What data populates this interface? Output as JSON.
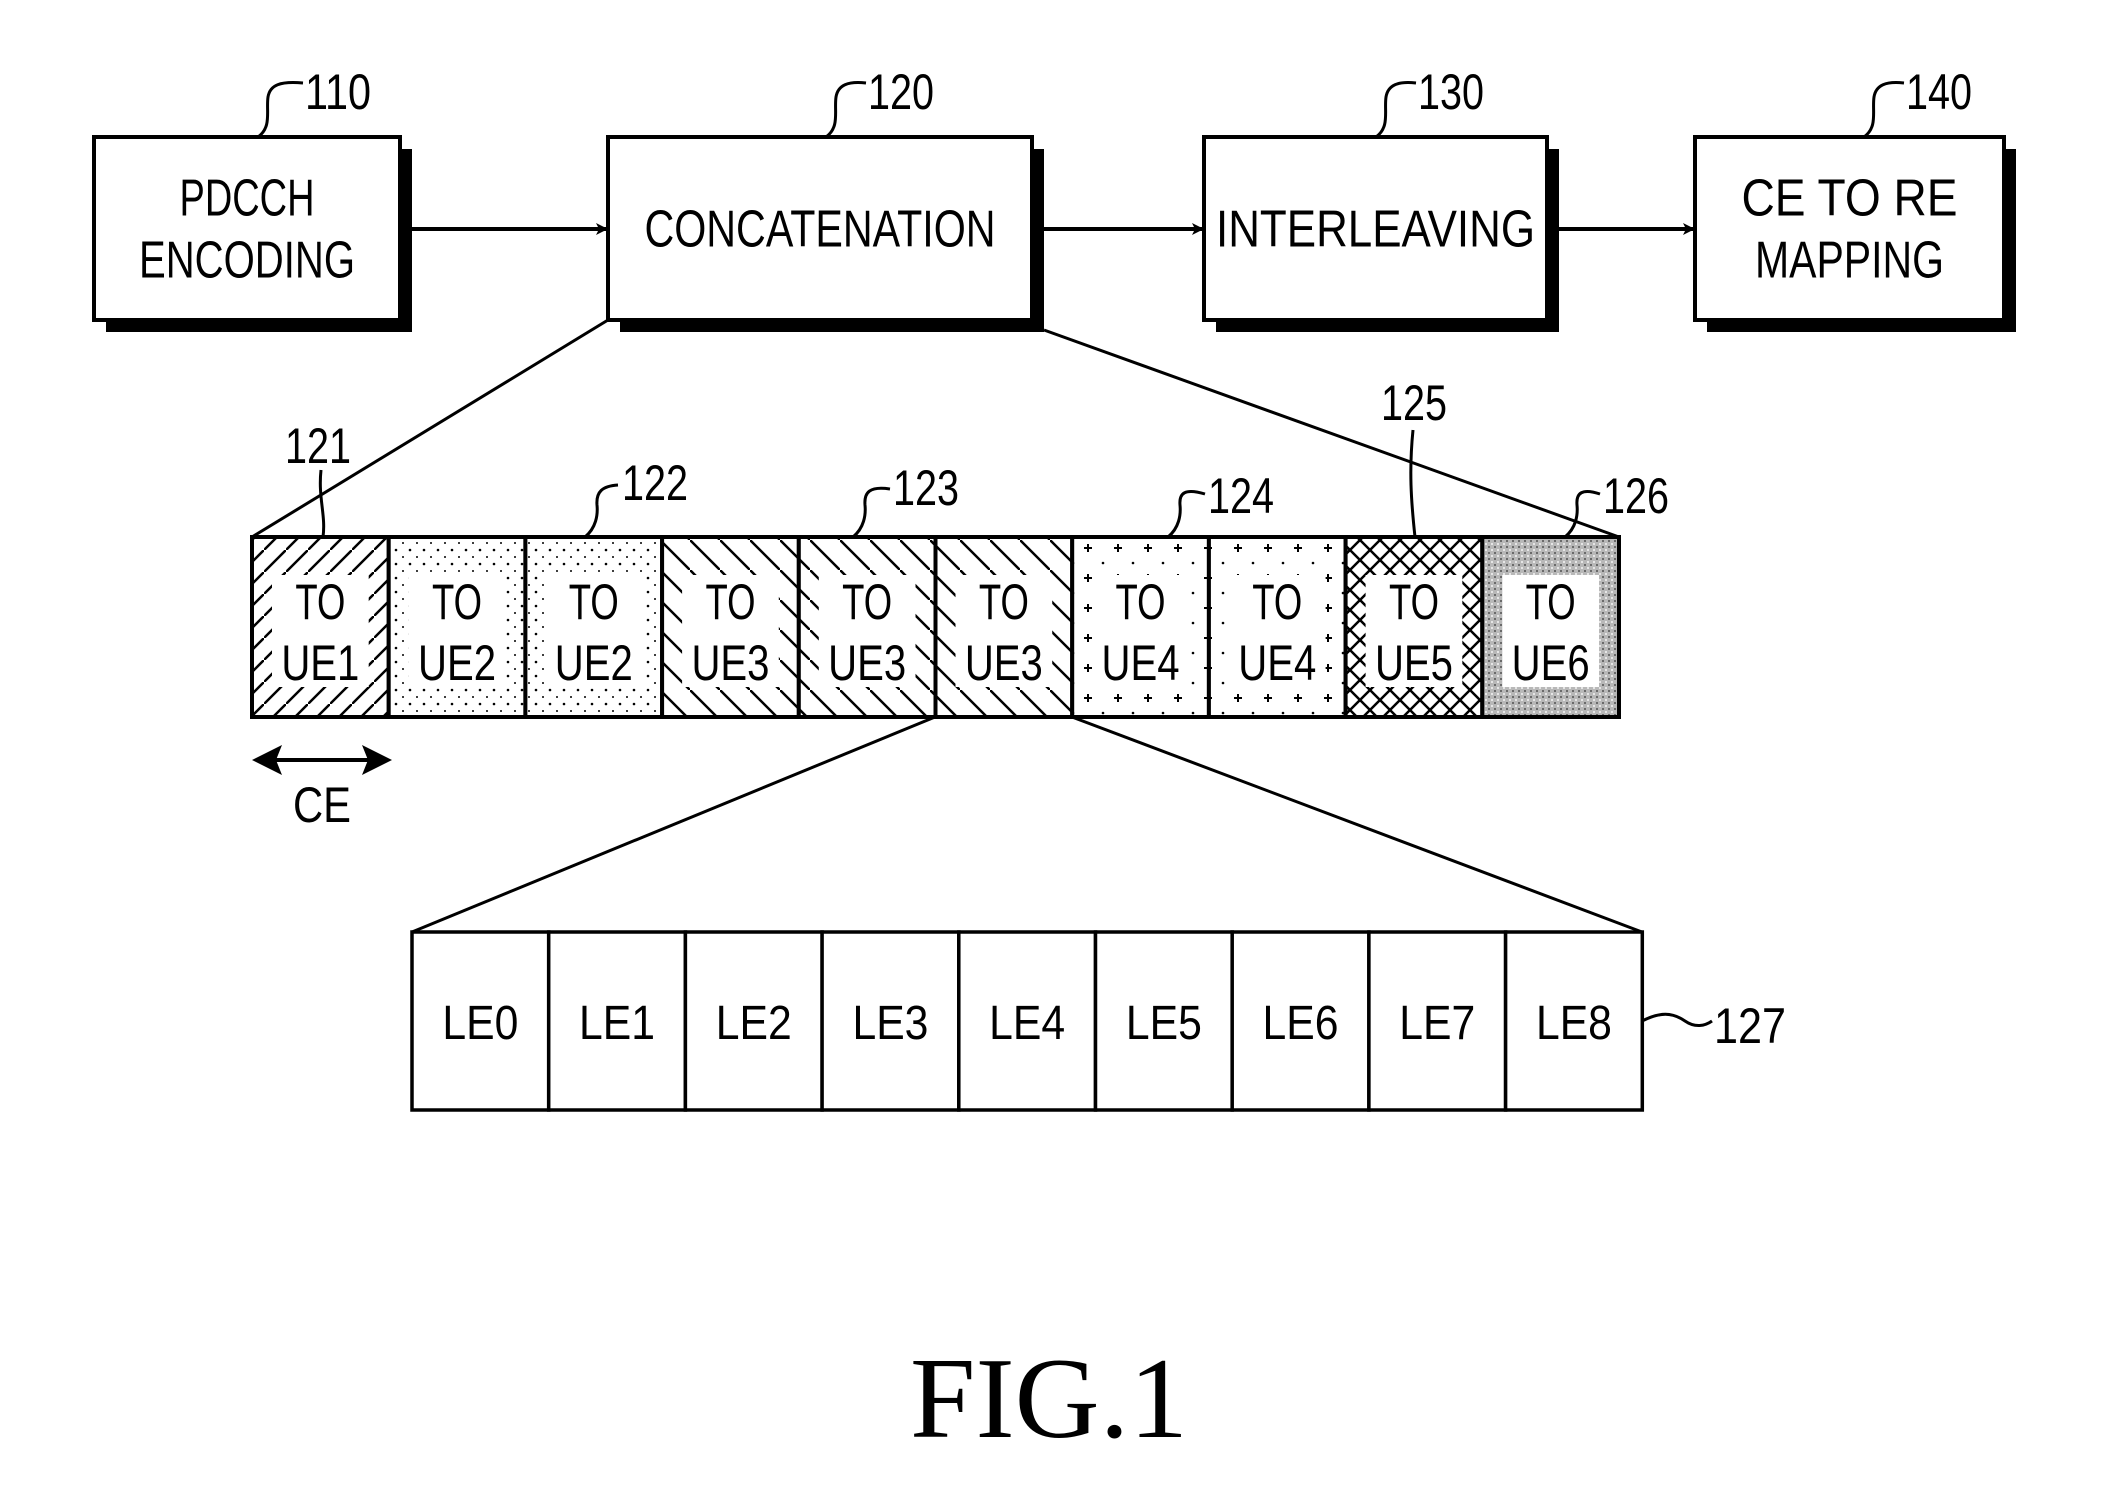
{
  "figure": {
    "caption": "FIG.1",
    "blocks": [
      {
        "ref": "110",
        "lines": [
          "PDCCH",
          "ENCODING"
        ]
      },
      {
        "ref": "120",
        "lines": [
          "CONCATENATION"
        ]
      },
      {
        "ref": "130",
        "lines": [
          "INTERLEAVING"
        ]
      },
      {
        "ref": "140",
        "lines": [
          "CE TO RE",
          "MAPPING"
        ]
      }
    ],
    "ue_cells": [
      {
        "line1": "TO",
        "line2": "UE1",
        "pattern": "hatch-forward"
      },
      {
        "line1": "TO",
        "line2": "UE2",
        "pattern": "dots"
      },
      {
        "line1": "TO",
        "line2": "UE2",
        "pattern": "dots"
      },
      {
        "line1": "TO",
        "line2": "UE3",
        "pattern": "hatch-back"
      },
      {
        "line1": "TO",
        "line2": "UE3",
        "pattern": "hatch-back"
      },
      {
        "line1": "TO",
        "line2": "UE3",
        "pattern": "hatch-back"
      },
      {
        "line1": "TO",
        "line2": "UE4",
        "pattern": "crosses"
      },
      {
        "line1": "TO",
        "line2": "UE4",
        "pattern": "crosses"
      },
      {
        "line1": "TO",
        "line2": "UE5",
        "pattern": "crosshatch"
      },
      {
        "line1": "TO",
        "line2": "UE6",
        "pattern": "gray-stipple"
      }
    ],
    "ue_refs": [
      "121",
      "122",
      "123",
      "124",
      "125",
      "126"
    ],
    "ce_label": "CE",
    "le_cells": [
      "LE0",
      "LE1",
      "LE2",
      "LE3",
      "LE4",
      "LE5",
      "LE6",
      "LE7",
      "LE8"
    ],
    "le_ref": "127"
  }
}
